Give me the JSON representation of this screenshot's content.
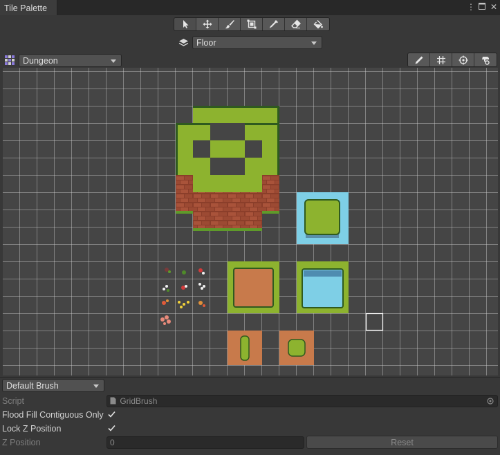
{
  "window": {
    "tab_title": "Tile Palette"
  },
  "toolbar": {
    "tools": [
      "select-tool",
      "move-tool",
      "paint-tool",
      "box-fill-tool",
      "pick-tool",
      "erase-tool",
      "flood-fill-tool"
    ],
    "active_tool": "select-tool"
  },
  "layer": {
    "selected": "Floor"
  },
  "palette": {
    "selected": "Dungeon"
  },
  "right_tools": [
    "edit-palette-icon",
    "grid-toggle-icon",
    "gizmos-icon",
    "palette-settings-icon"
  ],
  "inspector": {
    "brush": "Default Brush",
    "script_label": "Script",
    "script_value": "GridBrush",
    "flood_fill_label": "Flood Fill Contiguous Only",
    "flood_fill_checked": true,
    "lock_z_label": "Lock Z Position",
    "lock_z_checked": true,
    "z_position_label": "Z Position",
    "z_position_value": "0",
    "reset_label": "Reset"
  },
  "colors": {
    "background": "#383838",
    "grid": "#454545",
    "grass": "#8db32f",
    "dirt": "#a0522d",
    "water": "#7ecfe6",
    "sand": "#c87a4b"
  }
}
